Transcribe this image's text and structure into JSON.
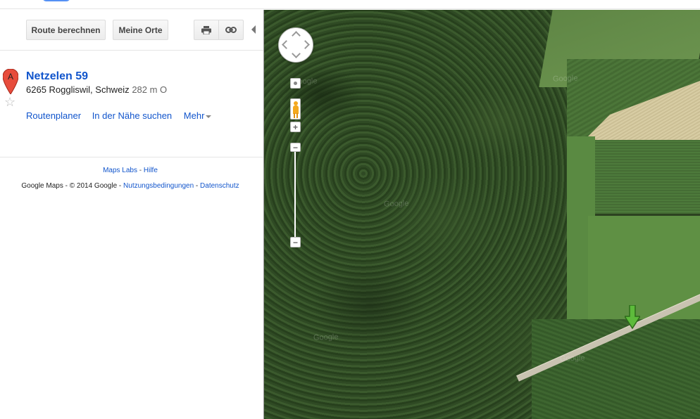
{
  "toolbar": {
    "route_label": "Route berechnen",
    "places_label": "Meine Orte",
    "print_icon": "print-icon",
    "link_icon": "link-icon"
  },
  "place": {
    "marker_letter": "A",
    "title": "Netzelen 59",
    "address": "6265 Roggliswil, Schweiz",
    "distance": "282 m O",
    "actions": [
      "Routenplaner",
      "In der Nähe suchen",
      "Mehr"
    ]
  },
  "footer": {
    "labs": "Maps Labs",
    "sep1": " - ",
    "help": "Hilfe",
    "copyright": "Google Maps - © 2014 Google - ",
    "terms": "Nutzungsbedingungen",
    "sep2": " - ",
    "privacy": "Datenschutz"
  },
  "map": {
    "zoom_in": "+",
    "zoom_out": "−",
    "watermark": "Google"
  },
  "colors": {
    "link": "#1155cc",
    "marker_red": "#e74c3c",
    "arrow_green": "#5dbb3b",
    "pegman": "#f4a81d"
  }
}
